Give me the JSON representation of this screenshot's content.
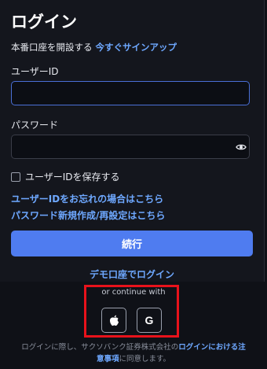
{
  "login": {
    "title": "ログイン",
    "subline_text": "本番口座を開設する",
    "signup_link": "今すぐサインアップ",
    "userid_label": "ユーザーID",
    "userid_value": "",
    "password_label": "パスワード",
    "password_value": "",
    "save_userid_label": "ユーザーIDを保存する",
    "forgot_userid_link": "ユーザーIDをお忘れの場合はこちら",
    "password_reset_link": "パスワード新規作成/再設定はこちら",
    "continue_button": "続行",
    "demo_link": "デモ口座でログイン"
  },
  "social": {
    "or_continue": "or continue with",
    "apple_icon": "apple-icon",
    "google_label": "G"
  },
  "footer": {
    "line1_prefix": "ログインに際し、サクソバンク証券株式会社の",
    "link_part1": "ログインにおける注",
    "link_part2": "意事項",
    "line2_suffix": "に同意します。"
  },
  "colors": {
    "background": "#0f1117",
    "panel": "#14161d",
    "accent": "#4f7cf0",
    "link": "#6ea8ff",
    "highlight_box": "#e8121b"
  }
}
